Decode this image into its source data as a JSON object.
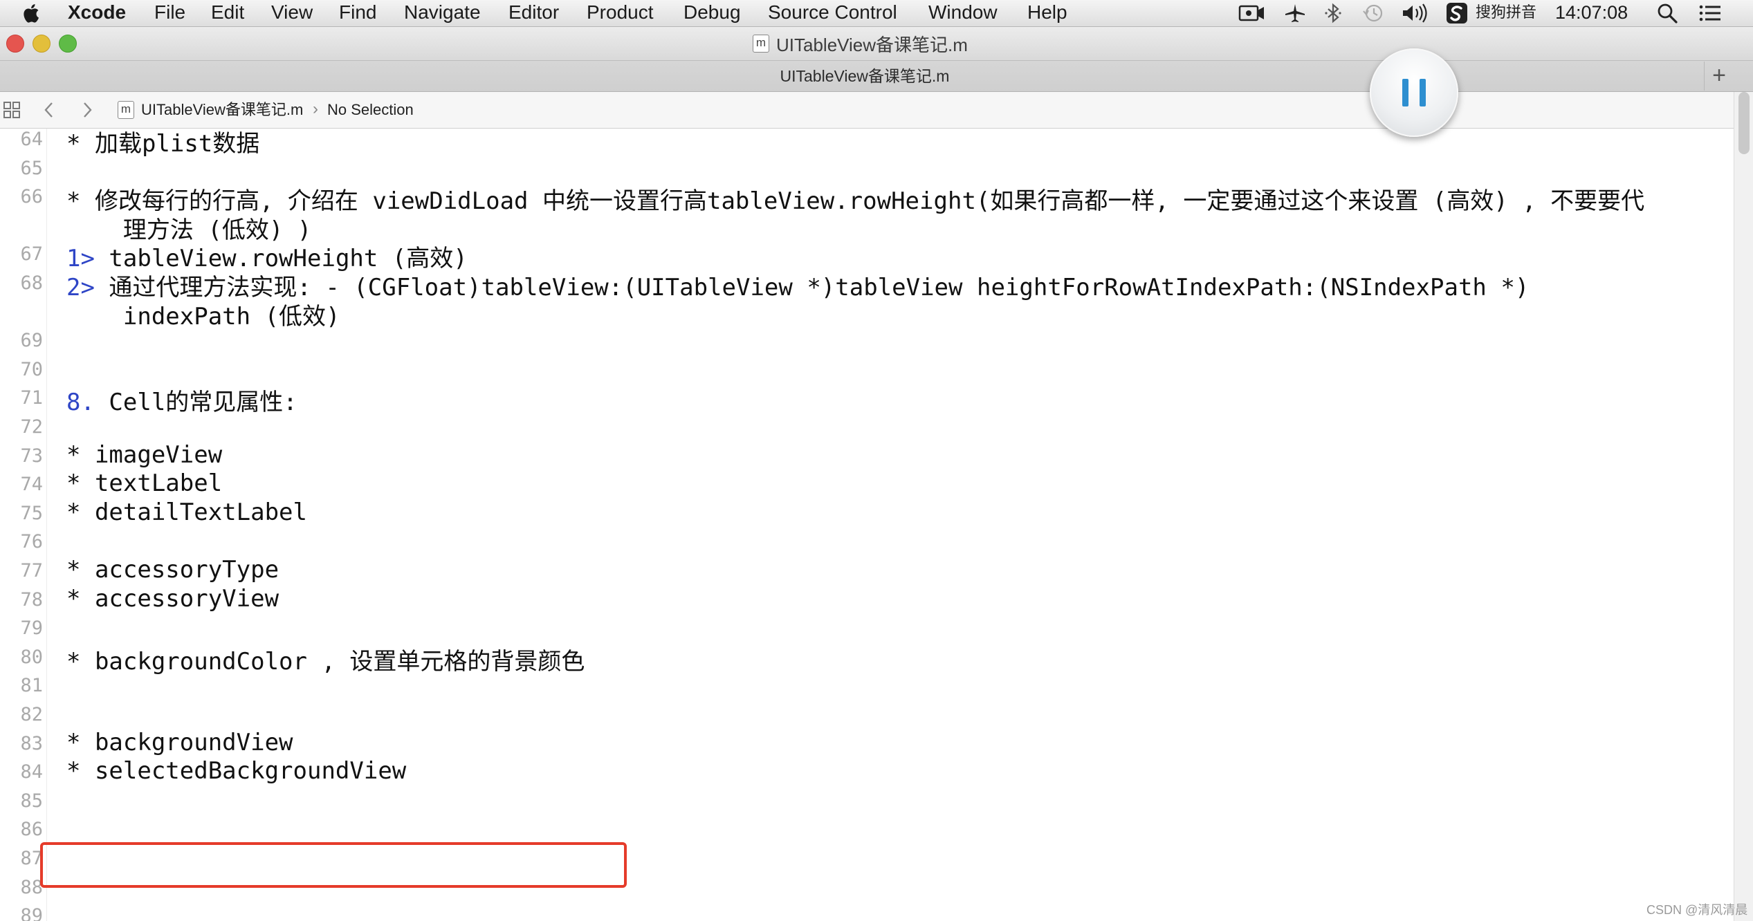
{
  "menubar": {
    "items": [
      "Xcode",
      "File",
      "Edit",
      "View",
      "Find",
      "Navigate",
      "Editor",
      "Product",
      "Debug",
      "Source Control",
      "Window",
      "Help"
    ],
    "ime_label": "搜狗拼音",
    "clock": "14:07:08",
    "tray_icons": [
      "screen-record-icon",
      "airplane-icon",
      "bluetooth-icon",
      "time-machine-icon",
      "volume-icon",
      "sogou-ime-icon",
      "spotlight-search-icon",
      "notification-center-icon"
    ]
  },
  "window": {
    "file_badge": "m",
    "title": "UITableView备课笔记.m"
  },
  "tabbar": {
    "title": "UITableView备课笔记.m",
    "new_tab": "+"
  },
  "jumpbar": {
    "file_badge": "m",
    "file": "UITableView备课笔记.m",
    "separator": "›",
    "selection": "No Selection"
  },
  "editor": {
    "lines": [
      {
        "n": "64",
        "text": "* 加载plist数据"
      },
      {
        "n": "65",
        "text": ""
      },
      {
        "n": "66",
        "text": "* 修改每行的行高, 介绍在 viewDidLoad 中统一设置行高tableView.rowHeight(如果行高都一样, 一定要通过这个来设置 (高效) , 不要要代"
      },
      {
        "n": "",
        "text": "    理方法 (低效) )"
      },
      {
        "n": "67",
        "num": "1>",
        "text": " tableView.rowHeight (高效)"
      },
      {
        "n": "68",
        "num": "2>",
        "text": " 通过代理方法实现: - (CGFloat)tableView:(UITableView *)tableView heightForRowAtIndexPath:(NSIndexPath *)"
      },
      {
        "n": "",
        "text": "    indexPath (低效)"
      },
      {
        "n": "69",
        "text": ""
      },
      {
        "n": "70",
        "text": ""
      },
      {
        "n": "71",
        "num": "8.",
        "text": " Cell的常见属性:"
      },
      {
        "n": "72",
        "text": ""
      },
      {
        "n": "73",
        "text": "* imageView"
      },
      {
        "n": "74",
        "text": "* textLabel"
      },
      {
        "n": "75",
        "text": "* detailTextLabel"
      },
      {
        "n": "76",
        "text": ""
      },
      {
        "n": "77",
        "text": "* accessoryType"
      },
      {
        "n": "78",
        "text": "* accessoryView"
      },
      {
        "n": "79",
        "text": ""
      },
      {
        "n": "80",
        "text": "* backgroundColor , 设置单元格的背景颜色"
      },
      {
        "n": "81",
        "text": ""
      },
      {
        "n": "82",
        "text": ""
      },
      {
        "n": "83",
        "text": "* backgroundView"
      },
      {
        "n": "84",
        "text": "* selectedBackgroundView"
      },
      {
        "n": "85",
        "text": ""
      },
      {
        "n": "86",
        "text": ""
      },
      {
        "n": "87",
        "text": ""
      },
      {
        "n": "88",
        "text": ""
      },
      {
        "n": "89",
        "text": ""
      }
    ]
  },
  "annotation": {
    "color": "#e53b2a"
  },
  "watermark": "CSDN @清风清晨"
}
